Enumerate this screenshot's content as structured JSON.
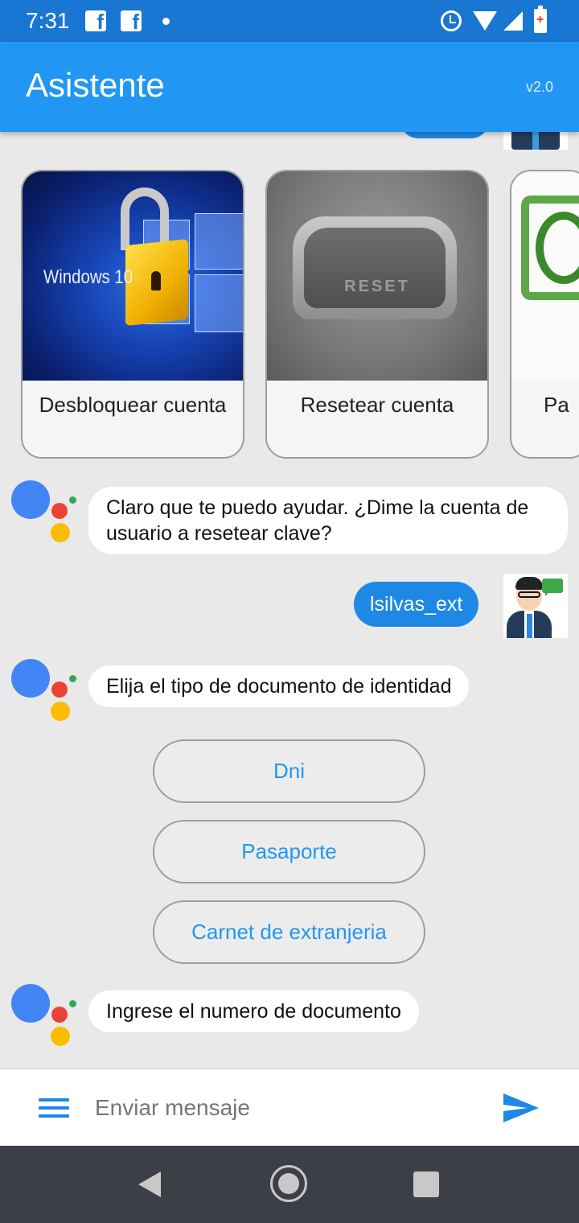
{
  "status_bar": {
    "time": "7:31",
    "icons": [
      "facebook-icon",
      "facebook-icon",
      "notification-dot-icon",
      "alarm-icon",
      "wifi-icon",
      "cell-signal-icon",
      "battery-charging-icon"
    ]
  },
  "app_bar": {
    "title": "Asistente",
    "version": "v2.0",
    "color": "#2196f3"
  },
  "cards": [
    {
      "label": "Desbloquear cuenta",
      "image_text": "Windows 10"
    },
    {
      "label": "Resetear cuenta",
      "image_text": "RESET"
    },
    {
      "label": "Pa"
    }
  ],
  "messages": [
    {
      "from": "bot",
      "text": "Claro que te puedo ayudar. ¿Dime la cuenta de usuario a resetear clave?"
    },
    {
      "from": "user",
      "text": "lsilvas_ext"
    },
    {
      "from": "bot",
      "text": "Elija el tipo de documento de identidad"
    },
    {
      "from": "bot",
      "text": "Ingrese el numero de documento"
    }
  ],
  "document_options": [
    {
      "label": "Dni"
    },
    {
      "label": "Pasaporte"
    },
    {
      "label": "Carnet de extranjeria"
    }
  ],
  "input_bar": {
    "placeholder": "Enviar mensaje",
    "menu_icon": "menu-icon",
    "send_icon": "send-icon",
    "accent": "#1e88e5"
  },
  "nav_bar": {
    "icons": [
      "back-icon",
      "home-icon",
      "recent-apps-icon"
    ]
  }
}
